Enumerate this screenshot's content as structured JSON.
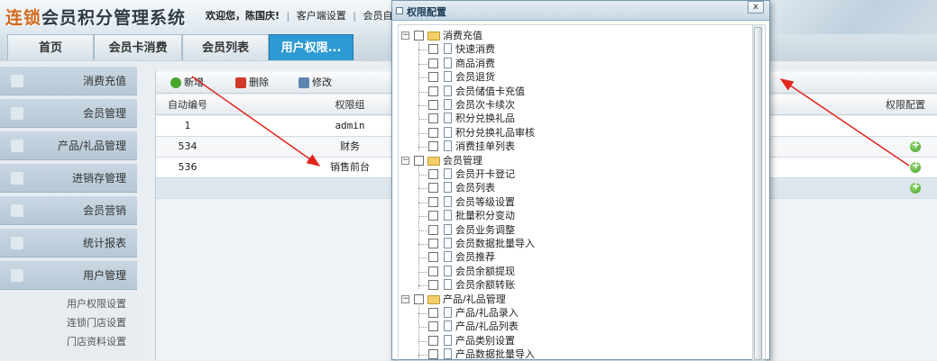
{
  "header": {
    "logo_part1": "连锁",
    "logo_part2": "会员积分管理系统",
    "welcome_prefix": "欢迎您，",
    "user_name": "陈国庆!",
    "link1": "客户端设置",
    "link2": "会员自助"
  },
  "tabs": [
    {
      "label": "首页"
    },
    {
      "label": "会员卡消费"
    },
    {
      "label": "会员列表"
    },
    {
      "label": "用户权限..."
    }
  ],
  "sidebar": {
    "items": [
      {
        "label": "消费充值"
      },
      {
        "label": "会员管理"
      },
      {
        "label": "产品/礼品管理"
      },
      {
        "label": "进销存管理"
      },
      {
        "label": "会员营销"
      },
      {
        "label": "统计报表"
      },
      {
        "label": "用户管理"
      }
    ],
    "subitems": [
      {
        "label": "用户权限设置"
      },
      {
        "label": "连锁门店设置"
      },
      {
        "label": "门店资料设置"
      }
    ]
  },
  "toolbar": {
    "add_label": "新增",
    "delete_label": "删除",
    "edit_label": "修改"
  },
  "grid": {
    "headers": {
      "id": "自动编号",
      "group": "权限组",
      "config": "权限配置"
    },
    "rows": [
      {
        "id": "1",
        "group": "admin"
      },
      {
        "id": "534",
        "group": "财务"
      },
      {
        "id": "536",
        "group": "销售前台"
      }
    ]
  },
  "dialog": {
    "title": "权限配置",
    "close_label": "x",
    "groups": [
      {
        "label": "消费充值",
        "children": [
          "快速消费",
          "商品消费",
          "会员退货",
          "会员储值卡充值",
          "会员次卡续次",
          "积分兑换礼品",
          "积分兑换礼品审核",
          "消费挂单列表"
        ]
      },
      {
        "label": "会员管理",
        "children": [
          "会员开卡登记",
          "会员列表",
          "会员等级设置",
          "批量积分变动",
          "会员业务调整",
          "会员数据批量导入",
          "会员推荐",
          "会员余额提现",
          "会员余额转账"
        ]
      },
      {
        "label": "产品/礼品管理",
        "children": [
          "产品/礼品录入",
          "产品/礼品列表",
          "产品类别设置",
          "产品数据批量导入"
        ]
      }
    ]
  }
}
